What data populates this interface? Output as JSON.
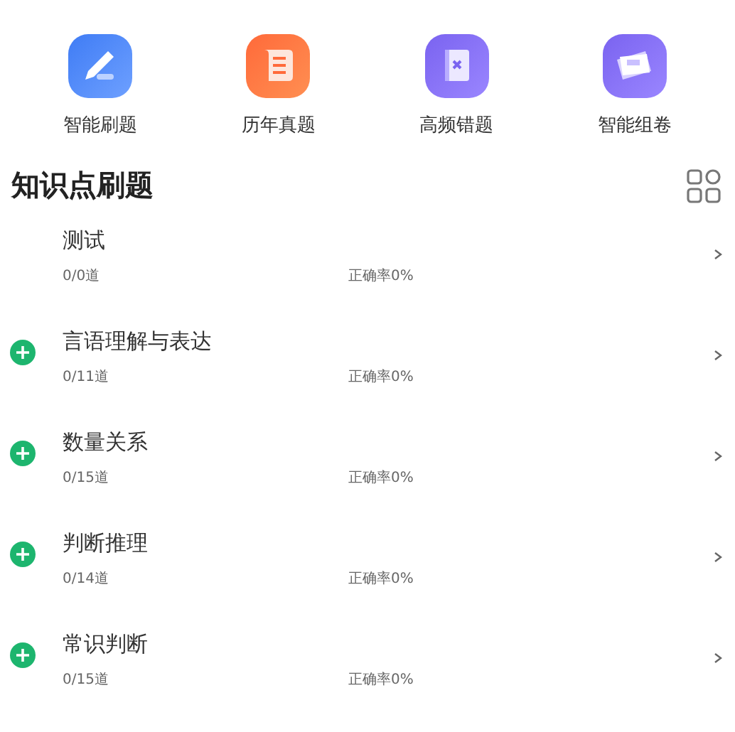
{
  "shortcuts": [
    {
      "label": "智能刷题"
    },
    {
      "label": "历年真题"
    },
    {
      "label": "高频错题"
    },
    {
      "label": "智能组卷"
    }
  ],
  "section": {
    "title": "知识点刷题"
  },
  "topics": [
    {
      "name": "测试",
      "count": "0/0道",
      "accuracy": "正确率0%",
      "expandable": false
    },
    {
      "name": "言语理解与表达",
      "count": "0/11道",
      "accuracy": "正确率0%",
      "expandable": true
    },
    {
      "name": "数量关系",
      "count": "0/15道",
      "accuracy": "正确率0%",
      "expandable": true
    },
    {
      "name": "判断推理",
      "count": "0/14道",
      "accuracy": "正确率0%",
      "expandable": true
    },
    {
      "name": "常识判断",
      "count": "0/15道",
      "accuracy": "正确率0%",
      "expandable": true
    }
  ]
}
